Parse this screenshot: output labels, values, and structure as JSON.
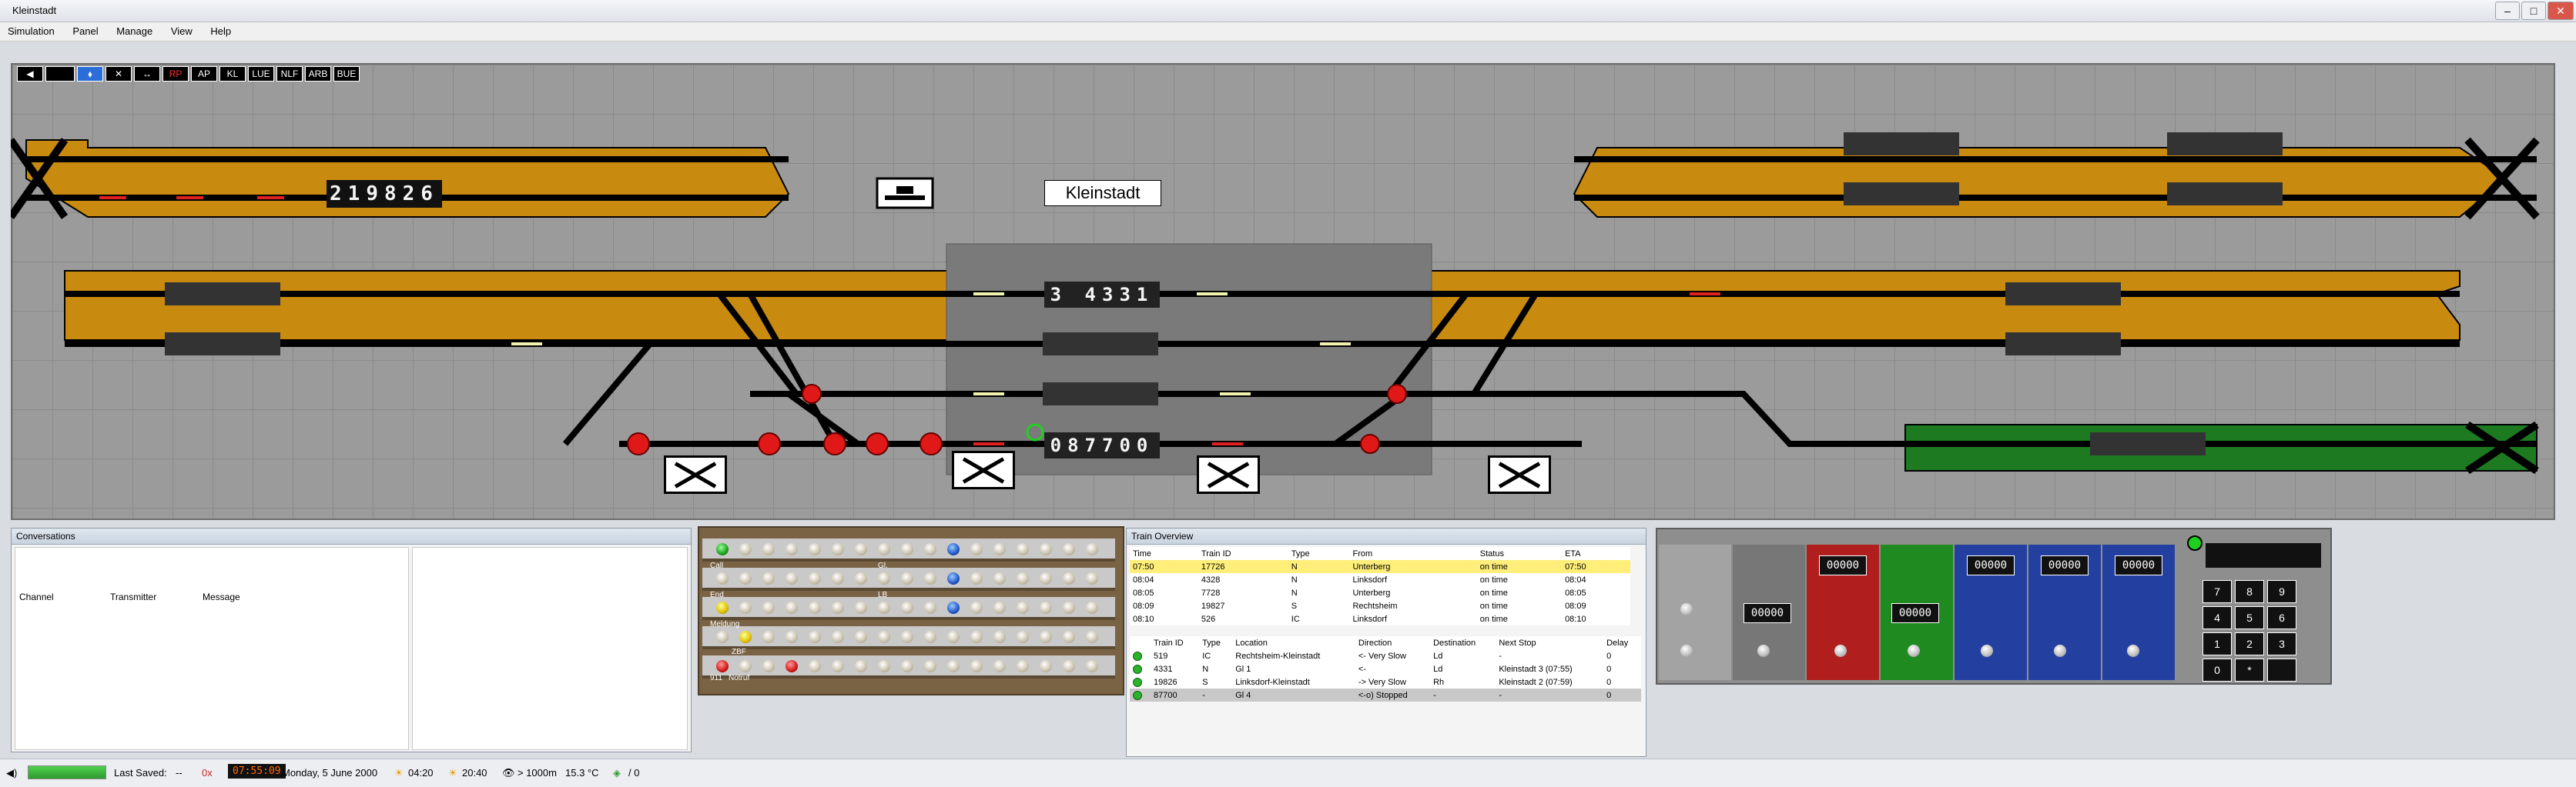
{
  "window": {
    "title": "Kleinstadt"
  },
  "menu": [
    "Simulation",
    "Panel",
    "Manage",
    "View",
    "Help"
  ],
  "panel_buttons": [
    "◀",
    "",
    "⬧",
    "✕",
    "↔",
    "RP",
    "AP",
    "KL",
    "LUE",
    "NLF",
    "ARB",
    "BUE"
  ],
  "panel": {
    "station_name": "Kleinstadt",
    "counter_top_left": "219826",
    "counter_center": "3 4331",
    "counter_bottom": "087700"
  },
  "conversations": {
    "title": "Conversations",
    "columns": [
      "Channel",
      "Transmitter",
      "Message"
    ]
  },
  "led_panel": {
    "labels": [
      "Call",
      "Gl.",
      "End",
      "LB",
      "Meldung",
      "ZBF",
      "911",
      "Notruf"
    ]
  },
  "train_overview": {
    "title": "Train Overview",
    "columns": [
      "Time",
      "Train ID",
      "Type",
      "From",
      "Status",
      "ETA"
    ],
    "rows": [
      [
        "07:50",
        "17726",
        "N",
        "Unterberg",
        "on time",
        "07:50"
      ],
      [
        "08:04",
        "4328",
        "N",
        "Linksdorf",
        "on time",
        "08:04"
      ],
      [
        "08:05",
        "7728",
        "N",
        "Unterberg",
        "on time",
        "08:05"
      ],
      [
        "08:09",
        "19827",
        "S",
        "Rechtsheim",
        "on time",
        "08:09"
      ],
      [
        "08:10",
        "526",
        "IC",
        "Linksdorf",
        "on time",
        "08:10"
      ]
    ],
    "columns2": [
      "Train ID",
      "Type",
      "Location",
      "Direction",
      "Destination",
      "Next Stop",
      "Delay"
    ],
    "rows2": [
      [
        "519",
        "IC",
        "Rechtsheim-Kleinstadt",
        "<- Very Slow",
        "Ld",
        "-",
        "0"
      ],
      [
        "4331",
        "N",
        "Gl 1",
        "<-",
        "Ld",
        "Kleinstadt 3 (07:55)",
        "0"
      ],
      [
        "19826",
        "S",
        "Linksdorf-Kleinstadt",
        "-> Very Slow",
        "Rh",
        "Kleinstadt 2 (07:59)",
        "0"
      ],
      [
        "87700",
        "-",
        "Gl 4",
        "<-o) Stopped",
        "-",
        "-",
        "0"
      ]
    ]
  },
  "control_panel": {
    "displays": [
      "00000",
      "00000",
      "00000",
      "00000",
      "00000",
      "00000"
    ]
  },
  "keypad": [
    "7",
    "8",
    "9",
    "4",
    "5",
    "6",
    "1",
    "2",
    "3",
    "0",
    "*",
    ""
  ],
  "statusbar": {
    "last_saved_label": "Last Saved:",
    "last_saved_value": "--",
    "speed": "0x",
    "clock": "07:55:09",
    "date": "Monday, 5 June 2000",
    "sunrise": "04:20",
    "sunset": "20:40",
    "visibility": "> 1000m",
    "temperature": "15.3 °C",
    "counter": "/ 0"
  }
}
